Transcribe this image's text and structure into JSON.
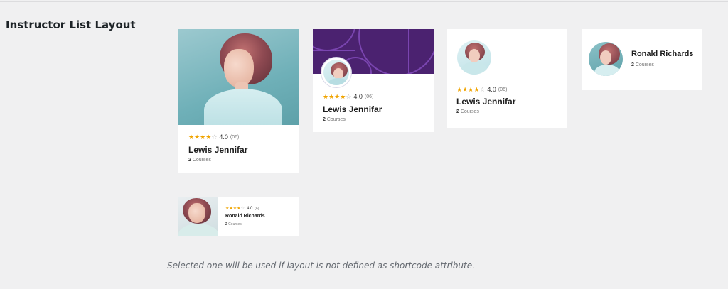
{
  "setting": {
    "label": "Instructor List Layout",
    "hint": "Selected one will be used if layout is not defined as shortcode attribute."
  },
  "layouts": [
    {
      "name": "Lewis Jennifar",
      "rating_value": "4.0",
      "rating_count": "(06)",
      "courses_count": "2",
      "courses_label": "Courses",
      "stars_filled": 4,
      "stars_total": 5
    },
    {
      "name": "Lewis Jennifar",
      "rating_value": "4.0",
      "rating_count": "(06)",
      "courses_count": "2",
      "courses_label": "Courses",
      "stars_filled": 4,
      "stars_total": 5
    },
    {
      "name": "Lewis Jennifar",
      "rating_value": "4.0",
      "rating_count": "(06)",
      "courses_count": "2",
      "courses_label": "Courses",
      "stars_filled": 4,
      "stars_total": 5
    },
    {
      "name": "Ronald Richards",
      "courses_count": "2",
      "courses_label": "Courses"
    },
    {
      "name": "Ronald Richards",
      "rating_value": "4.0",
      "rating_count": "(6)",
      "courses_count": "2",
      "courses_label": "Courses",
      "stars_filled": 4,
      "stars_total": 5
    }
  ],
  "colors": {
    "page_bg": "#f0f0f1",
    "card_bg": "#ffffff",
    "star": "#f0a400",
    "cover": "#4b2270"
  }
}
